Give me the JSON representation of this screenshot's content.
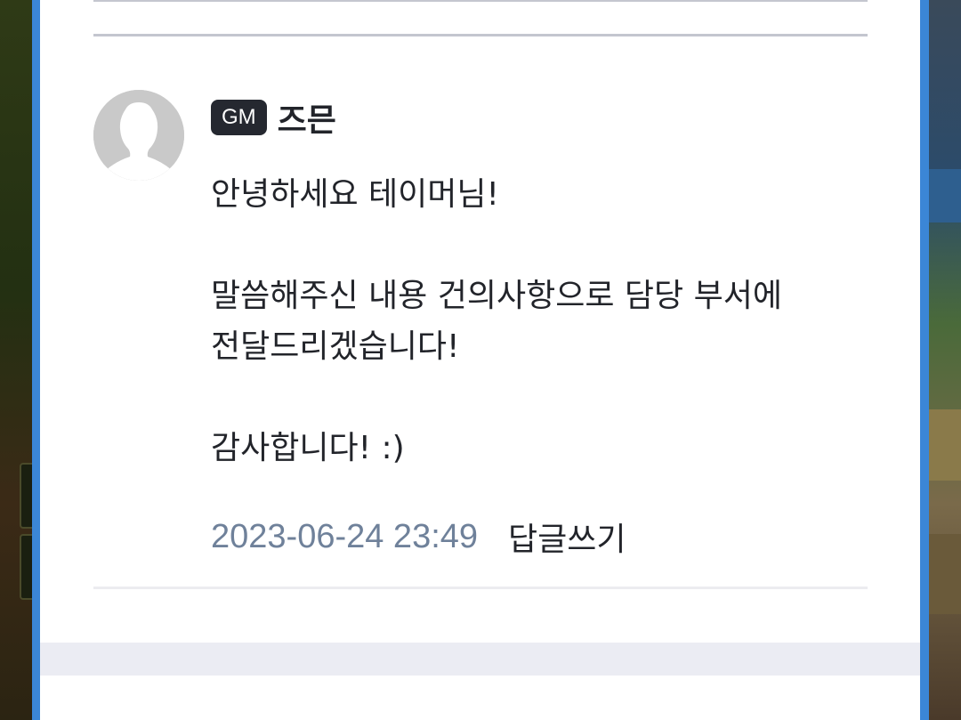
{
  "comment": {
    "badge": "GM",
    "author": "즈믄",
    "message": "안녕하세요 테이머님!\n\n말씀해주신 내용 건의사항으로 담당 부서에\n전달드리겠습니다!\n\n감사합니다! :)",
    "timestamp": "2023-06-24 23:49",
    "reply_label": "답글쓰기",
    "avatar_icon": "default-user-avatar-icon"
  },
  "colors": {
    "frame": "#3b86d6",
    "badge_bg": "#252830",
    "timestamp": "#6f819a",
    "text": "#22242a",
    "divider": "#c4c6cf",
    "band": "#ebecf3"
  }
}
